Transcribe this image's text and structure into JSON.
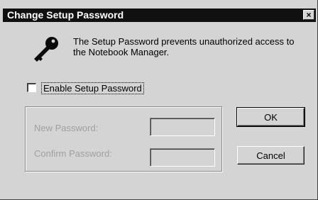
{
  "window": {
    "title": "Change Setup Password",
    "close_glyph": "×"
  },
  "icon": "key-icon",
  "message": {
    "line1": "The Setup Password prevents unauthorized access to",
    "line2": "the Notebook Manager."
  },
  "enable_checkbox": {
    "label": "Enable Setup Password",
    "checked": false
  },
  "fields": {
    "new_password_label": "New Password:",
    "confirm_password_label": "Confirm Password:"
  },
  "buttons": {
    "ok_label": "OK",
    "cancel_label": "Cancel"
  },
  "colors": {
    "dialog_background": "#d4d4d4",
    "titlebar": "#101010",
    "disabled_text": "#a0a0a0"
  }
}
